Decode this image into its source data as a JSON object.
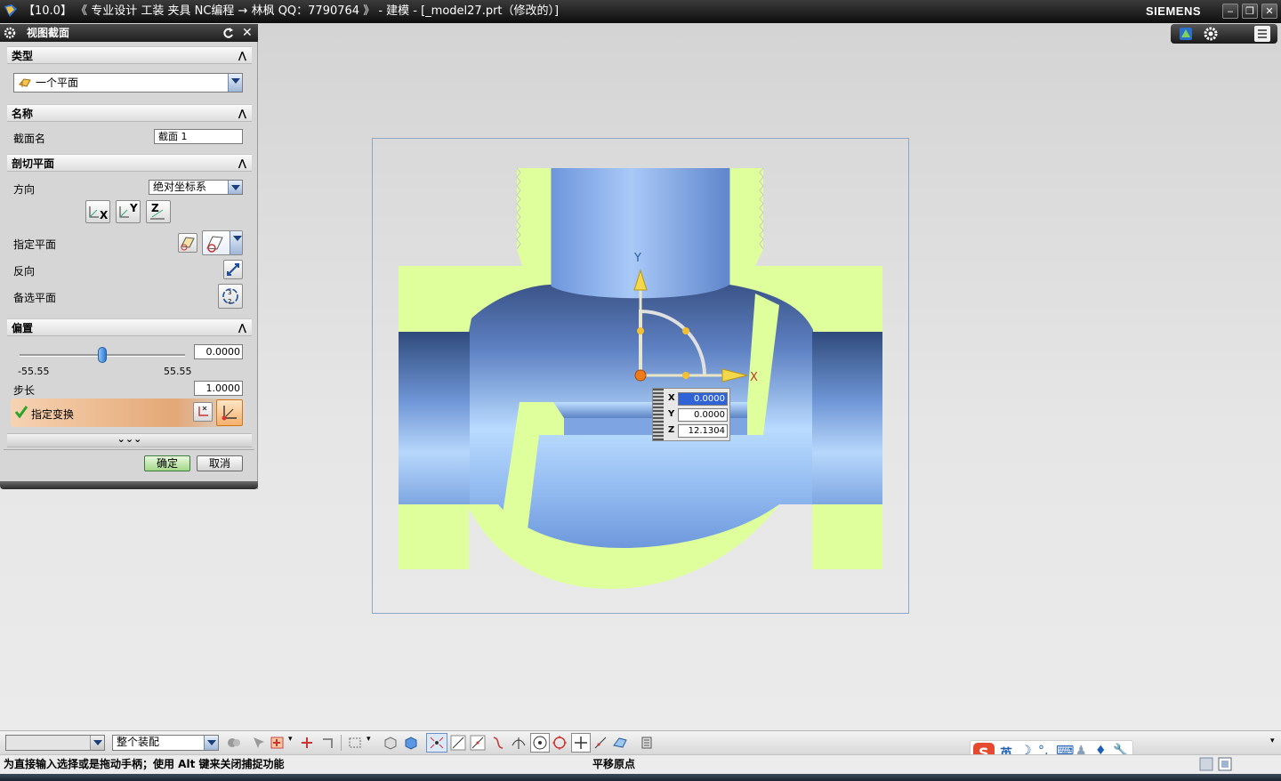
{
  "window": {
    "title": "【10.0】  《 专业设计 工装 夹具 NC编程 → 林枫 QQ：7790764 》 - 建模 - [_model27.prt（修改的）]",
    "brand": "SIEMENS",
    "minimize": "‒",
    "restore": "❐",
    "close": "✕"
  },
  "dialog": {
    "title": "视图截面",
    "reset_icon": "reset-icon",
    "close_label": "✕",
    "type_section": {
      "header": "类型",
      "selected": "一个平面"
    },
    "name_section": {
      "header": "名称",
      "label": "截面名",
      "value": "截面 1"
    },
    "cut_plane_section": {
      "header": "剖切平面",
      "direction_label": "方向",
      "direction_value": "绝对坐标系",
      "axis_x": "X",
      "axis_y": "Y",
      "axis_z": "Z",
      "specify_plane_label": "指定平面",
      "reverse_label": "反向",
      "alternate_plane_label": "备选平面"
    },
    "offset_section": {
      "header": "偏置",
      "value": "0.0000",
      "min": "-55.55",
      "max": "55.55",
      "slider_fraction": 0.5,
      "step_label": "步长",
      "step_value": "1.0000",
      "transform_label": "指定变换"
    },
    "expand_label": "⌄⌄⌄",
    "ok_label": "确定",
    "cancel_label": "取消"
  },
  "viewport": {
    "axis_x": "X",
    "axis_y": "Y",
    "coords": {
      "x_label": "X",
      "x_value": "0.0000",
      "y_label": "Y",
      "y_value": "0.0000",
      "z_label": "Z",
      "z_value": "12.1304"
    }
  },
  "bottom_toolbar": {
    "filter_value": "",
    "scope_value": "整个装配"
  },
  "status": {
    "prompt": "为直接输入选择或是拖动手柄；使用 Alt 键来关闭捕捉功能",
    "mode": "平移原点"
  },
  "ime": {
    "lang": "英"
  },
  "colors": {
    "section_fill": "#deff9c",
    "body_blue": "#7aa6e6",
    "accent_orange": "#e58a3c"
  }
}
